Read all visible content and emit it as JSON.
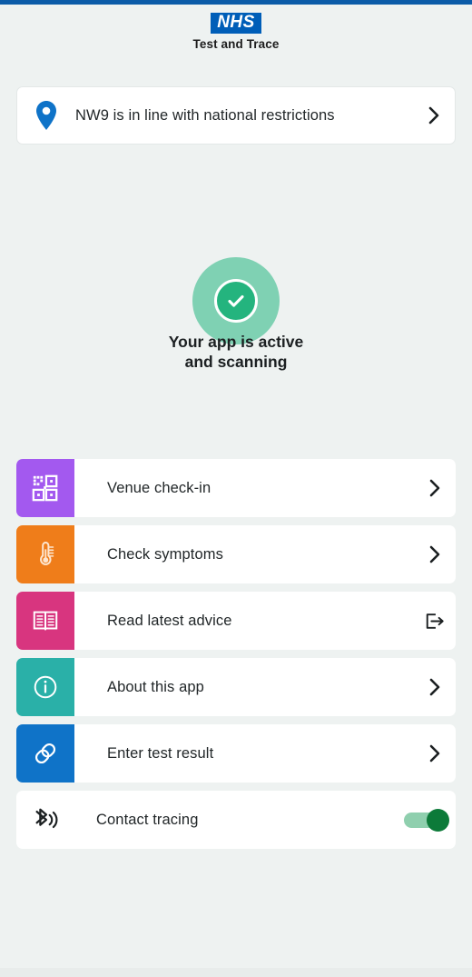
{
  "app": {
    "logo_text": "NHS",
    "subtitle": "Test and Trace"
  },
  "location_card": {
    "icon": "map-pin-icon",
    "text": "NW9 is in line with national restrictions",
    "chevron": "chevron-right-icon"
  },
  "status": {
    "icon": "check-circle-icon",
    "line1": "Your app is active",
    "line2": "and scanning",
    "outer_color": "#7fd1b3",
    "inner_color": "#24b47e"
  },
  "menu": {
    "items": [
      {
        "label": "Venue check-in",
        "icon": "qr-code-icon",
        "tile_color": "#a359ef",
        "action_icon": "chevron-right-icon"
      },
      {
        "label": "Check symptoms",
        "icon": "thermometer-icon",
        "tile_color": "#ef7d1a",
        "action_icon": "chevron-right-icon"
      },
      {
        "label": "Read latest advice",
        "icon": "open-book-icon",
        "tile_color": "#d8357f",
        "action_icon": "external-link-icon"
      },
      {
        "label": "About this app",
        "icon": "info-circle-icon",
        "tile_color": "#2ab0a8",
        "action_icon": "chevron-right-icon"
      },
      {
        "label": "Enter test result",
        "icon": "link-chain-icon",
        "tile_color": "#0f73c8",
        "action_icon": "chevron-right-icon"
      },
      {
        "label": "Contact tracing",
        "icon": "bluetooth-icon",
        "tile_color": "#ffffff",
        "action_icon": "toggle-switch-on"
      }
    ]
  },
  "colors": {
    "background": "#eef2f1",
    "nhs_blue": "#005eb8",
    "top_bar": "#0b5ca8",
    "toggle_on": "#0c7a39",
    "toggle_track": "#8fcfae"
  }
}
